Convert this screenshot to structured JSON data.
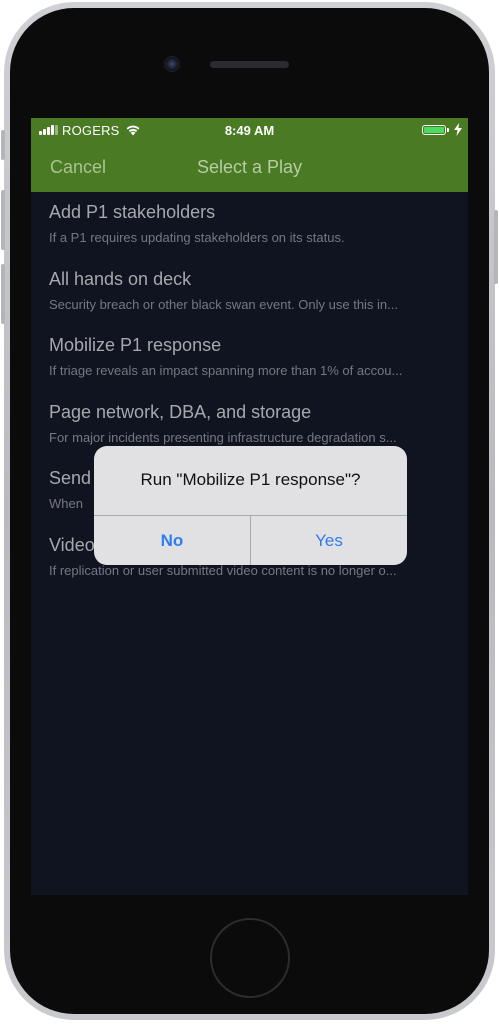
{
  "status_bar": {
    "carrier": "ROGERS",
    "time": "8:49 AM"
  },
  "nav": {
    "cancel_label": "Cancel",
    "title": "Select a Play"
  },
  "plays": [
    {
      "title": "Add P1 stakeholders",
      "description": "If a P1 requires updating stakeholders on its status."
    },
    {
      "title": "All hands on deck",
      "description": "Security breach or other black swan event. Only use this in..."
    },
    {
      "title": "Mobilize P1 response",
      "description": "If triage reveals an impact spanning more than 1% of accou..."
    },
    {
      "title": "Page network, DBA, and storage",
      "description": "For major incidents presenting infrastructure degradation s..."
    },
    {
      "title": "Send",
      "description": "When"
    },
    {
      "title": "Video",
      "description": "If replication or user submitted video content is no longer o..."
    }
  ],
  "alert": {
    "title": "Run \"Mobilize P1 response\"?",
    "no_label": "No",
    "yes_label": "Yes"
  },
  "colors": {
    "nav_bar": "#4a7a24",
    "screen_background": "#0f1420",
    "alert_button_text": "#2f7ef0",
    "battery": "#4cd964"
  }
}
